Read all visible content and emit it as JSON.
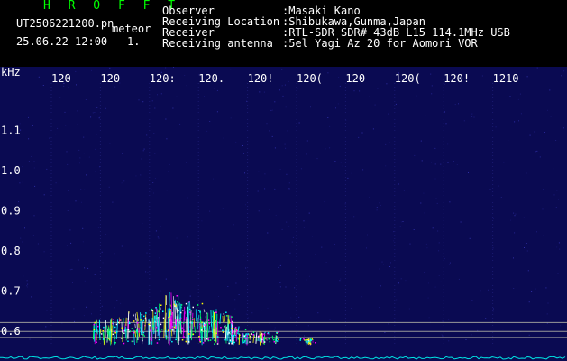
{
  "app_title": "H R O F F T",
  "file_name": "UT2506221200.pn",
  "mode": "meteor",
  "datetime": "25.06.22 12:00",
  "index": "1.",
  "info": [
    {
      "key": "Observer",
      "value": ":Masaki Kano"
    },
    {
      "key": "Receiving Location",
      "value": ":Shibukawa,Gunma,Japan"
    },
    {
      "key": "Receiver",
      "value": ":RTL-SDR SDR# 43dB L15 114.1MHz USB"
    },
    {
      "key": "Receiving antenna",
      "value": ":5el Yagi Az 20 for Aomori VOR"
    }
  ],
  "colors": {
    "background": "#000000",
    "plot_background": "#0a0a52",
    "title": "#00ff00",
    "text": "#ffffff",
    "echo": [
      "#00ffff",
      "#00ff66",
      "#ff00ff",
      "#ffff00",
      "#ffffff"
    ]
  },
  "chart_data": {
    "type": "heatmap",
    "ylabel": "kHz",
    "y_ticks": [
      "1.1",
      "1.0",
      "0.9",
      "0.8",
      "0.7",
      "0.6"
    ],
    "ylim": [
      0.56,
      1.16
    ],
    "x_ticks": [
      "120",
      "120",
      "120:",
      "120.",
      "120!",
      "120(",
      "120",
      "120(",
      "120!",
      "1210"
    ],
    "xlim_minutes": [
      0,
      10
    ],
    "reference_lines_khz": [
      0.622,
      0.6,
      0.585
    ],
    "meteor_echoes": [
      {
        "t": 1.05,
        "f_min": 0.57,
        "f_max": 0.63,
        "intensity": 0.7
      },
      {
        "t": 1.35,
        "f_min": 0.57,
        "f_max": 0.635,
        "intensity": 0.8
      },
      {
        "t": 1.7,
        "f_min": 0.57,
        "f_max": 0.65,
        "intensity": 0.75
      },
      {
        "t": 2.0,
        "f_min": 0.57,
        "f_max": 0.665,
        "intensity": 0.8
      },
      {
        "t": 2.3,
        "f_min": 0.57,
        "f_max": 0.67,
        "intensity": 0.85
      },
      {
        "t": 2.5,
        "f_min": 0.57,
        "f_max": 0.7,
        "intensity": 0.95
      },
      {
        "t": 2.7,
        "f_min": 0.57,
        "f_max": 0.68,
        "intensity": 0.9
      },
      {
        "t": 2.95,
        "f_min": 0.57,
        "f_max": 0.675,
        "intensity": 0.85
      },
      {
        "t": 3.2,
        "f_min": 0.57,
        "f_max": 0.66,
        "intensity": 0.85
      },
      {
        "t": 3.5,
        "f_min": 0.57,
        "f_max": 0.65,
        "intensity": 0.8
      },
      {
        "t": 3.75,
        "f_min": 0.57,
        "f_max": 0.62,
        "intensity": 0.7
      },
      {
        "t": 4.1,
        "f_min": 0.57,
        "f_max": 0.6,
        "intensity": 0.6
      },
      {
        "t": 4.45,
        "f_min": 0.57,
        "f_max": 0.6,
        "intensity": 0.55
      },
      {
        "t": 5.25,
        "f_min": 0.57,
        "f_max": 0.585,
        "intensity": 0.4
      }
    ]
  }
}
